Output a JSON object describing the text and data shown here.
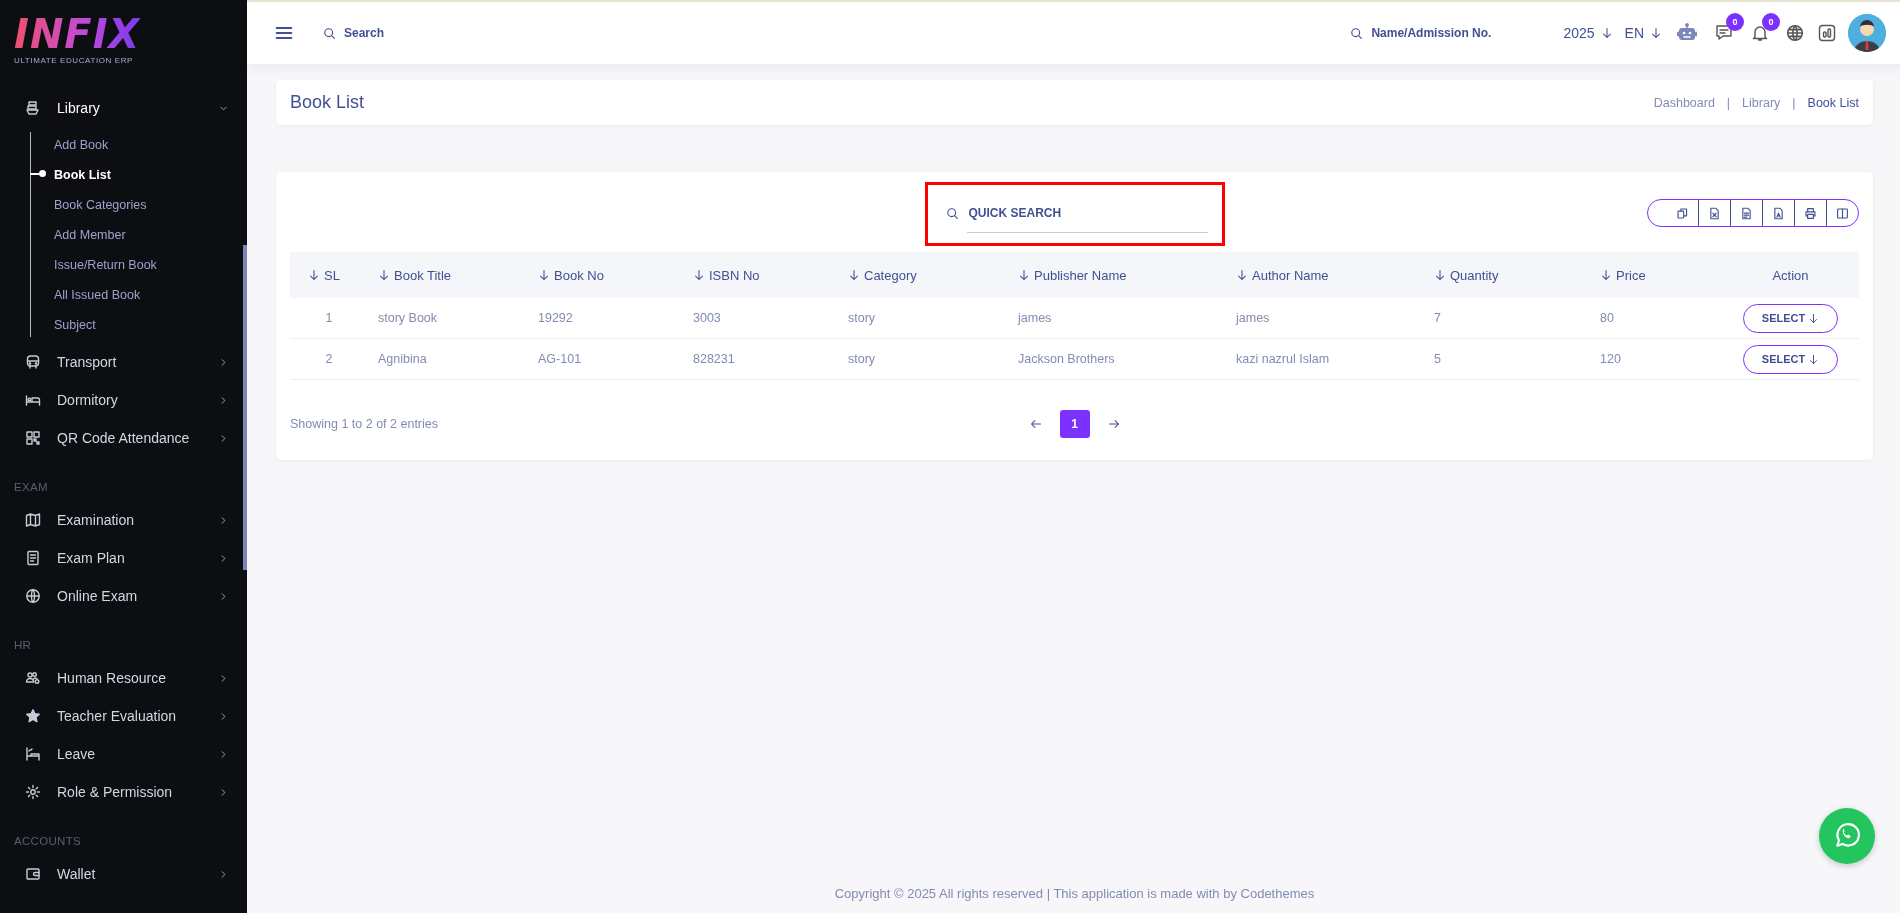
{
  "sidebar": {
    "logo": {
      "title": "INFIX",
      "subtitle": "ULTIMATE EDUCATION ERP"
    },
    "sections": [
      {
        "items": [
          {
            "label": "Library",
            "expanded": true,
            "children": [
              {
                "label": "Add Book",
                "selected": false
              },
              {
                "label": "Book List",
                "selected": true
              },
              {
                "label": "Book Categories",
                "selected": false
              },
              {
                "label": "Add Member",
                "selected": false
              },
              {
                "label": "Issue/Return Book",
                "selected": false
              },
              {
                "label": "All Issued Book",
                "selected": false
              },
              {
                "label": "Subject",
                "selected": false
              }
            ]
          },
          {
            "label": "Transport",
            "expanded": false
          },
          {
            "label": "Dormitory",
            "expanded": false
          },
          {
            "label": "QR Code Attendance",
            "expanded": false
          }
        ]
      },
      {
        "heading": "EXAM",
        "items": [
          {
            "label": "Examination",
            "expanded": false
          },
          {
            "label": "Exam Plan",
            "expanded": false
          },
          {
            "label": "Online Exam",
            "expanded": false
          }
        ]
      },
      {
        "heading": "HR",
        "items": [
          {
            "label": "Human Resource",
            "expanded": false
          },
          {
            "label": "Teacher Evaluation",
            "expanded": false
          },
          {
            "label": "Leave",
            "expanded": false
          },
          {
            "label": "Role & Permission",
            "expanded": false
          }
        ]
      },
      {
        "heading": "ACCOUNTS",
        "items": [
          {
            "label": "Wallet",
            "expanded": false
          }
        ]
      }
    ]
  },
  "header": {
    "search": {
      "placeholder": "Search"
    },
    "student_search": {
      "placeholder": "Name/Admission No."
    },
    "year": "2025",
    "language": "EN",
    "messages_badge": "0",
    "notifications_badge": "0"
  },
  "page_title_bar": {
    "title": "Book List",
    "separator": "|",
    "breadcrumbs": [
      {
        "label": "Dashboard",
        "selected": false
      },
      {
        "label": "Library",
        "selected": false
      },
      {
        "label": "Book List",
        "selected": true
      }
    ]
  },
  "table_card": {
    "quick_search": {
      "placeholder": "QUICK SEARCH",
      "highlighted": true
    },
    "columns": [
      {
        "label": "SL",
        "sortable": true
      },
      {
        "label": "Book Title",
        "sortable": true
      },
      {
        "label": "Book No",
        "sortable": true
      },
      {
        "label": "ISBN No",
        "sortable": true
      },
      {
        "label": "Category",
        "sortable": true
      },
      {
        "label": "Publisher Name",
        "sortable": true
      },
      {
        "label": "Author Name",
        "sortable": true
      },
      {
        "label": "Quantity",
        "sortable": true
      },
      {
        "label": "Price",
        "sortable": true
      },
      {
        "label": "Action",
        "sortable": false
      }
    ],
    "rows": [
      {
        "cells": [
          "1",
          "story Book",
          "19292",
          "3003",
          "story",
          "james",
          "james",
          "7",
          "80"
        ],
        "action": "SELECT"
      },
      {
        "cells": [
          "2",
          "Agnibina",
          "AG-101",
          "828231",
          "story",
          "Jackson Brothers",
          "kazi nazrul Islam",
          "5",
          "120"
        ],
        "action": "SELECT"
      }
    ],
    "info": "Showing 1 to 2 of 2 entries",
    "pages": [
      {
        "label": "1",
        "selected": true
      }
    ]
  },
  "footer": {
    "copyright": "Copyright © 2025 All rights reserved | This application is made with by Codethemes"
  }
}
